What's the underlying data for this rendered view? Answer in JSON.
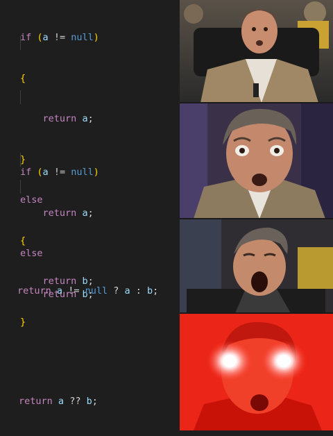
{
  "code_blocks": {
    "block1": {
      "line1": {
        "kw": "if",
        "open": "(",
        "var": "a",
        "op": " != ",
        "null": "null",
        "close": ")"
      },
      "line2": "{",
      "line3": {
        "kw": "return",
        "var": "a",
        "semi": ";"
      },
      "line4": "}",
      "line5": "else",
      "line6": "{",
      "line7": {
        "kw": "return",
        "var": "b",
        "semi": ";"
      },
      "line8": "}"
    },
    "block2": {
      "line1": {
        "kw": "if",
        "open": "(",
        "var": "a",
        "op": " != ",
        "null": "null",
        "close": ")"
      },
      "line2": {
        "kw": "return",
        "var": "a",
        "semi": ";"
      },
      "line3": "else",
      "line4": {
        "kw": "return",
        "var": "b",
        "semi": ";"
      }
    },
    "block3": {
      "kw": "return",
      "a": "a",
      "op1": " != ",
      "null": "null",
      "op2": " ? ",
      "b1": "a",
      "op3": " : ",
      "b2": "b",
      "semi": ";"
    },
    "block4": {
      "kw": "return",
      "a": "a",
      "op": " ?? ",
      "b": "b",
      "semi": ";"
    }
  },
  "reaction_panels": [
    "surprised-man-panel",
    "shocked-man-panel",
    "astonished-man-panel",
    "glowing-eyes-red-man-panel"
  ]
}
